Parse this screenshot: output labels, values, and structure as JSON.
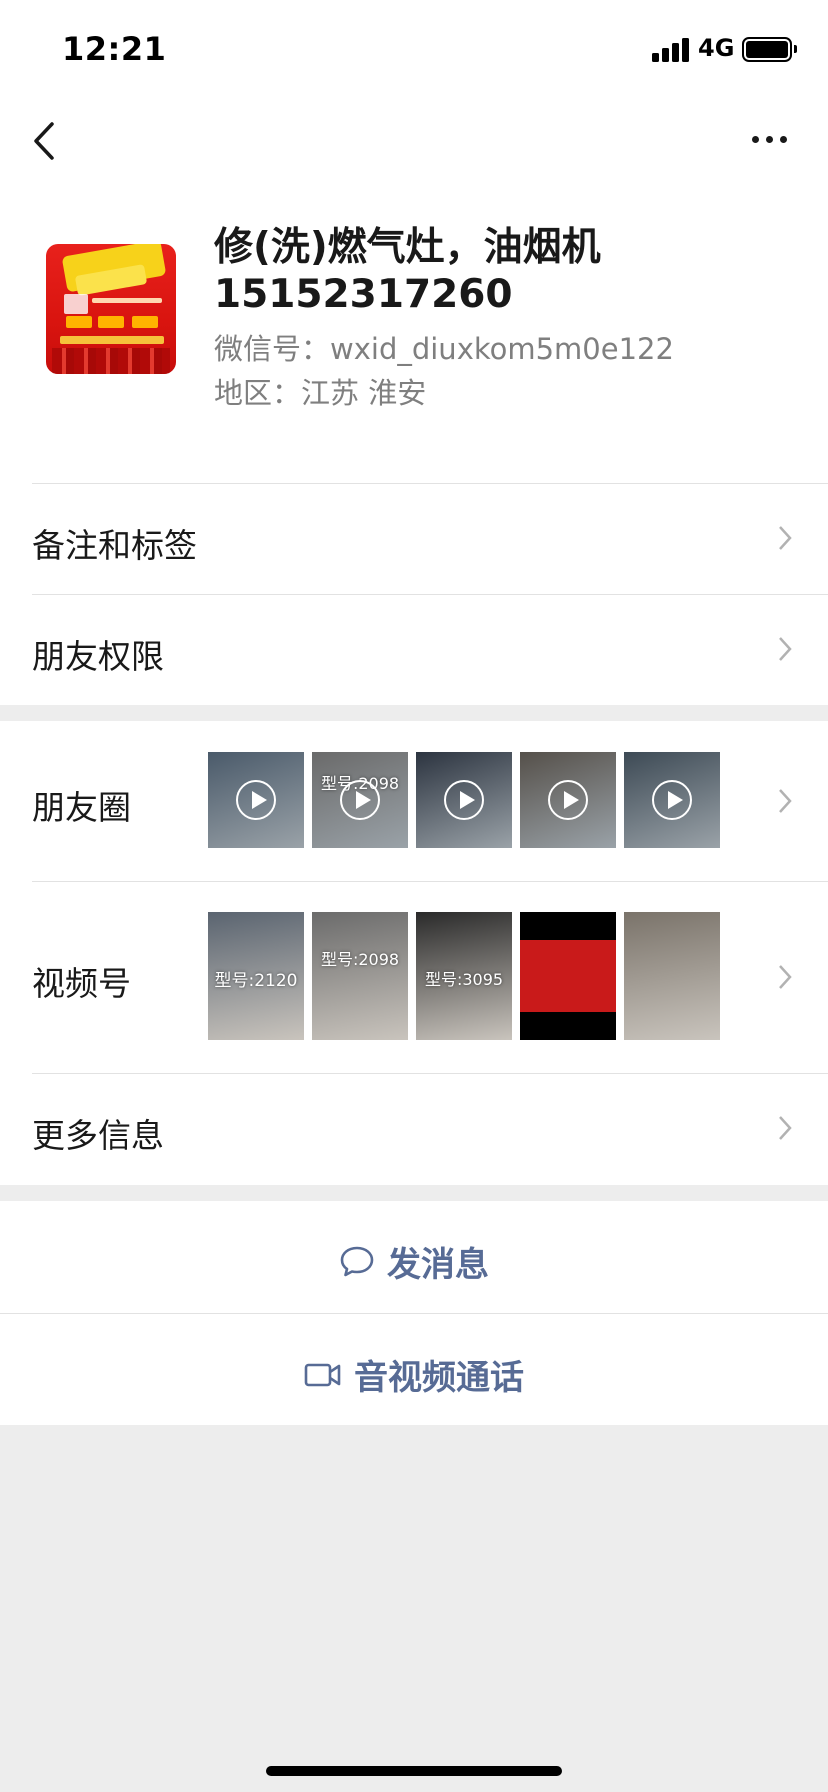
{
  "status_bar": {
    "time": "12:21",
    "network": "4G"
  },
  "profile": {
    "name": "修(洗)燃气灶，油烟机15152317260",
    "wechat_id": "微信号：wxid_diuxkom5m0e122",
    "region": "地区：江苏 淮安"
  },
  "rows": {
    "remarks": "备注和标签",
    "permissions": "朋友权限",
    "moments": "朋友圈",
    "channels": "视频号",
    "more_info": "更多信息"
  },
  "moments_thumbs": [
    {
      "caption": "",
      "has_play": true,
      "color": "#4a5a6a"
    },
    {
      "caption": "型号:2098",
      "has_play": true,
      "color": "#6a6a6a"
    },
    {
      "caption": "",
      "has_play": true,
      "color": "#2c3440"
    },
    {
      "caption": "",
      "has_play": true,
      "color": "#55504a"
    },
    {
      "caption": "",
      "has_play": true,
      "color": "#3d4a55"
    }
  ],
  "channels_thumbs": [
    {
      "caption": "型号:2120",
      "color": "#5a6470"
    },
    {
      "caption": "型号:2098",
      "color": "#6b6b6b"
    },
    {
      "caption": "型号:3095",
      "color": "#2a2a2a"
    },
    {
      "caption": "",
      "color": "#c91a1a"
    },
    {
      "caption": "",
      "color": "#7a736a"
    }
  ],
  "actions": {
    "message": "发消息",
    "call": "音视频通话"
  },
  "colors": {
    "link": "#576b95",
    "background": "#ededed"
  }
}
